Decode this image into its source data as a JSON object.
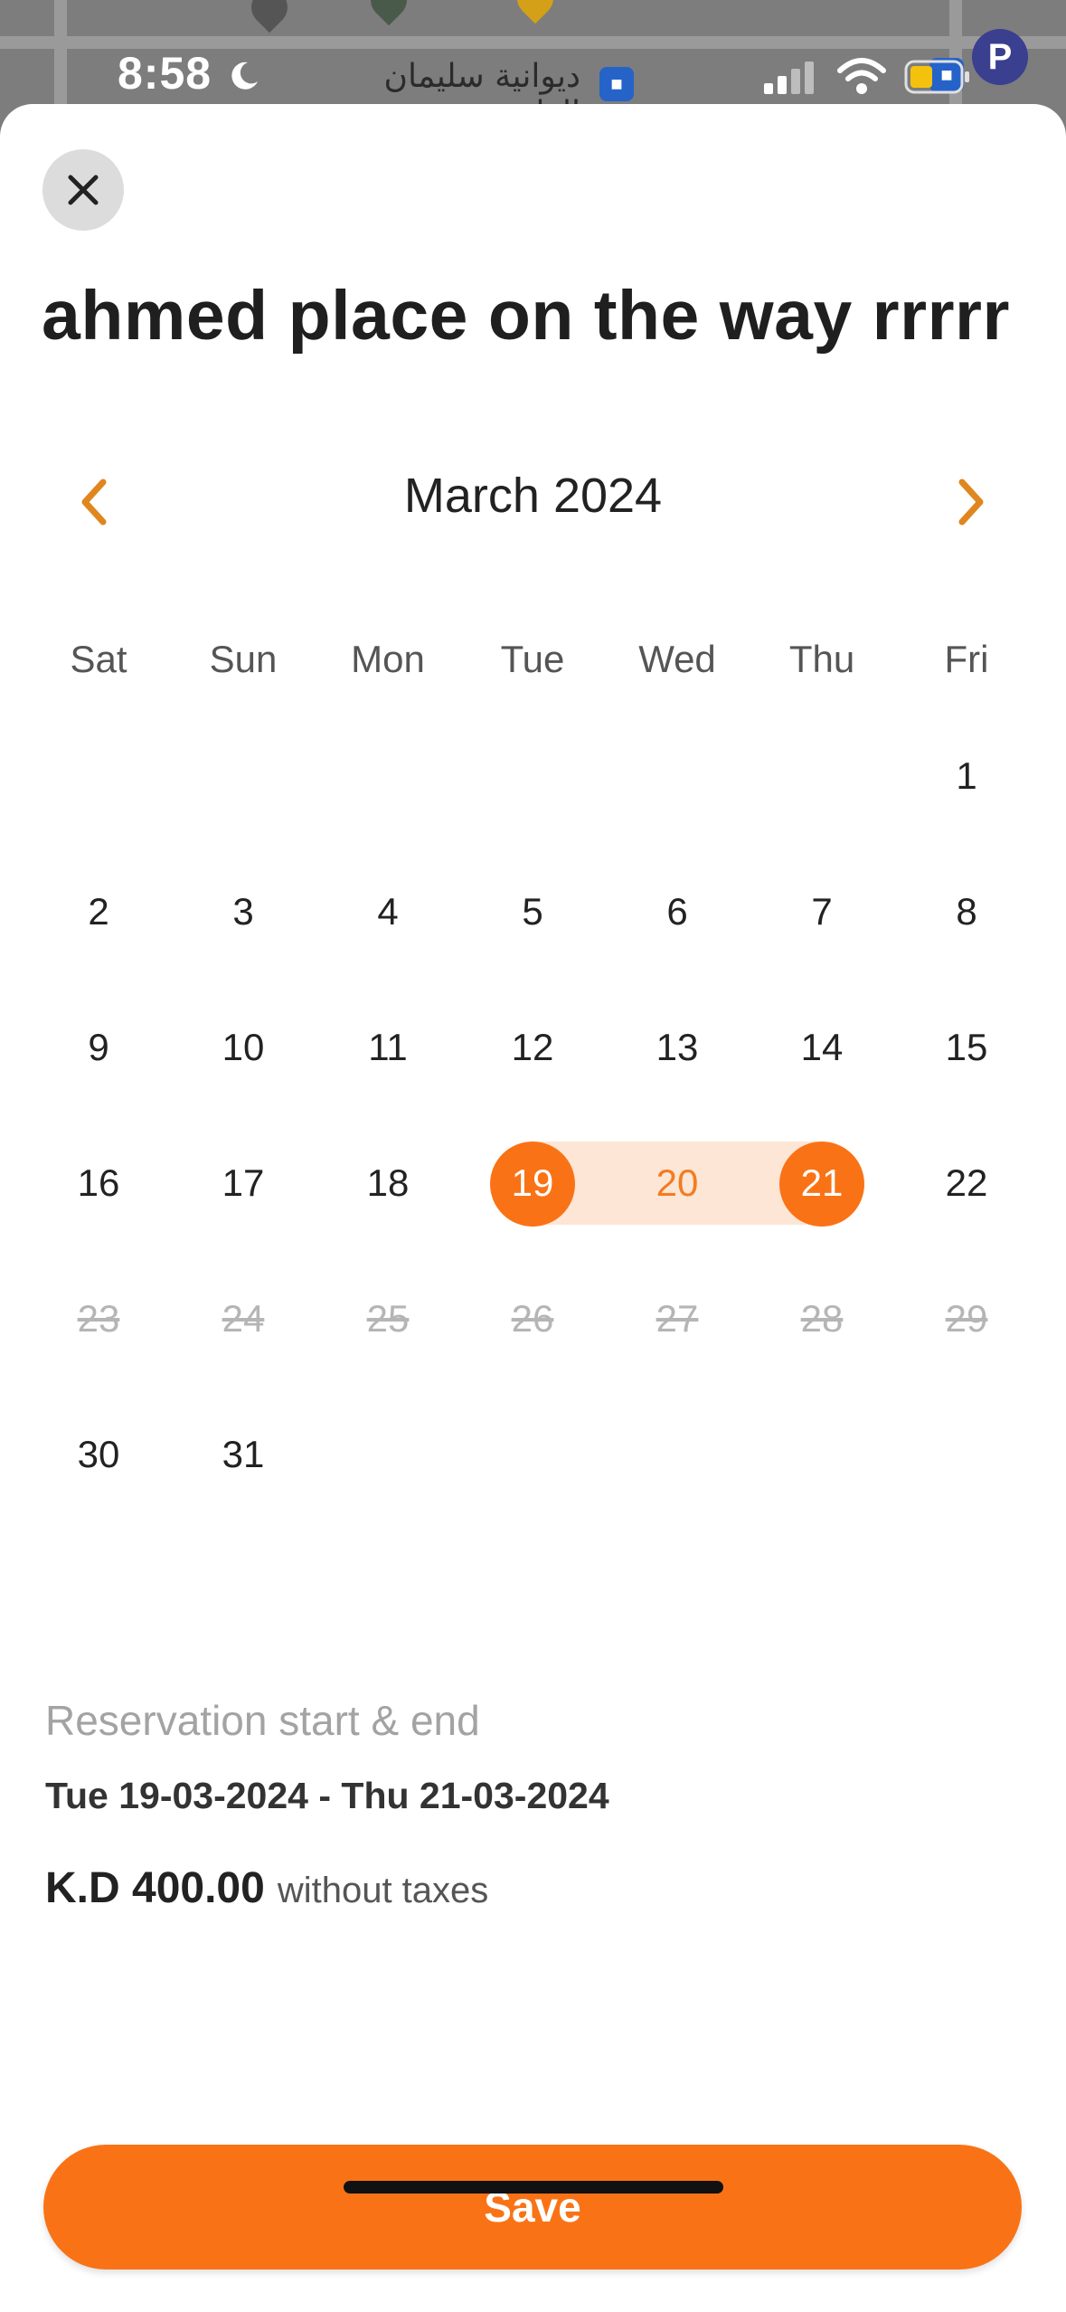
{
  "status_bar": {
    "time": "8:58"
  },
  "map": {
    "place_label": "ديوانية سليمان الطريجي"
  },
  "sheet": {
    "title": "ahmed place on the way rrrrr"
  },
  "calendar": {
    "month_label": "March 2024",
    "weekdays": [
      "Sat",
      "Sun",
      "Mon",
      "Tue",
      "Wed",
      "Thu",
      "Fri"
    ],
    "weeks": [
      [
        "",
        "",
        "",
        "",
        "",
        "",
        "1"
      ],
      [
        "2",
        "3",
        "4",
        "5",
        "6",
        "7",
        "8"
      ],
      [
        "9",
        "10",
        "11",
        "12",
        "13",
        "14",
        "15"
      ],
      [
        "16",
        "17",
        "18",
        "19",
        "20",
        "21",
        "22"
      ],
      [
        "23",
        "24",
        "25",
        "26",
        "27",
        "28",
        "29"
      ],
      [
        "30",
        "31",
        "",
        "",
        "",
        "",
        ""
      ]
    ],
    "range_start": "19",
    "range_end": "21",
    "in_range": [
      "20"
    ],
    "disabled_days": [
      "23",
      "24",
      "25",
      "26",
      "27",
      "28",
      "29"
    ]
  },
  "reservation": {
    "label": "Reservation start & end",
    "dates": "Tue 19-03-2024 - Thu 21-03-2024",
    "price": "K.D 400.00",
    "price_note": "without taxes"
  },
  "actions": {
    "save_label": "Save"
  },
  "colors": {
    "accent": "#f97316",
    "range_fill": "#fde6d6",
    "in_range_text": "#f47b20",
    "disabled_text": "#b5b5b5"
  },
  "icons": {
    "close": "close-icon",
    "prev": "chevron-left-icon",
    "next": "chevron-right-icon"
  }
}
